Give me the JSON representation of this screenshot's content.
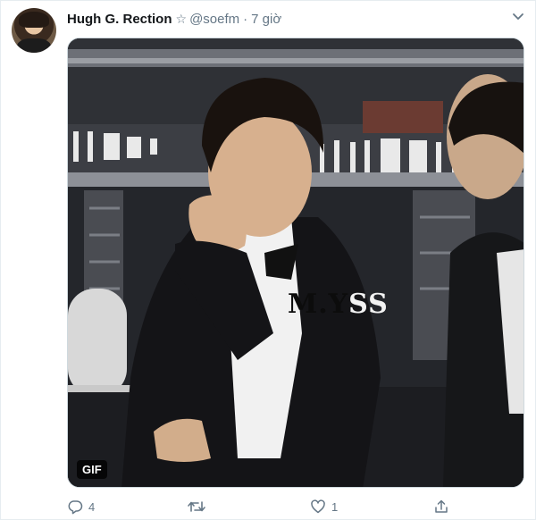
{
  "tweet": {
    "author": {
      "display_name": "Hugh G. Rection",
      "star": "☆",
      "handle": "@soefm",
      "separator": "·",
      "time": "7 giờ"
    },
    "media": {
      "watermark_dark": "M.Y",
      "watermark_light": "SS",
      "badge": "GIF"
    },
    "actions": {
      "reply_count": "4",
      "retweet_count": "",
      "like_count": "1"
    }
  }
}
